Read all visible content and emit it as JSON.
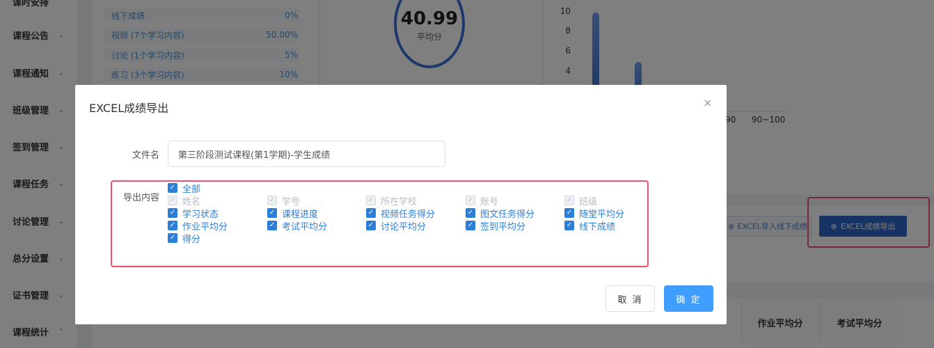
{
  "sidebar": {
    "items": [
      {
        "label": "课时安排"
      },
      {
        "label": "课程公告"
      },
      {
        "label": "课程通知"
      },
      {
        "label": "班级管理"
      },
      {
        "label": "签到管理"
      },
      {
        "label": "课程任务"
      },
      {
        "label": "讨论管理"
      },
      {
        "label": "总分设置"
      },
      {
        "label": "证书管理"
      },
      {
        "label": "课程统计"
      }
    ]
  },
  "stats": {
    "rows": [
      {
        "name": "线下成绩",
        "value": "0%"
      },
      {
        "name": "视频 (7个学习内容)",
        "value": "50.00%"
      },
      {
        "name": "讨论 (1个学习内容)",
        "value": "5%"
      },
      {
        "name": "练习 (3个学习内容)",
        "value": "10%"
      }
    ],
    "average_score": "40.99",
    "average_label": "平均分"
  },
  "chart": {
    "y_ticks": [
      "10",
      "8",
      "6",
      "4"
    ],
    "x_ticks": [
      "90",
      "90~100"
    ]
  },
  "toolbar": {
    "import_label": "EXCEL导入线下成绩",
    "export_label": "EXCEL成绩导出"
  },
  "table": {
    "headers": [
      "作业平均分",
      "考试平均分"
    ]
  },
  "modal": {
    "title": "EXCEL成绩导出",
    "filename_label": "文件名",
    "filename_value": "第三阶段测试课程(第1学期)-学生成绩",
    "content_label": "导出内容",
    "select_all": "全部",
    "options": [
      {
        "label": "姓名",
        "checked": true,
        "disabled": true
      },
      {
        "label": "学号",
        "checked": true,
        "disabled": true
      },
      {
        "label": "所在学校",
        "checked": true,
        "disabled": true
      },
      {
        "label": "账号",
        "checked": true,
        "disabled": true
      },
      {
        "label": "班级",
        "checked": true,
        "disabled": true
      },
      {
        "label": "学习状态",
        "checked": true,
        "disabled": false
      },
      {
        "label": "课程进度",
        "checked": true,
        "disabled": false
      },
      {
        "label": "视频任务得分",
        "checked": true,
        "disabled": false
      },
      {
        "label": "图文任务得分",
        "checked": true,
        "disabled": false
      },
      {
        "label": "随堂平均分",
        "checked": true,
        "disabled": false
      },
      {
        "label": "作业平均分",
        "checked": true,
        "disabled": false
      },
      {
        "label": "考试平均分",
        "checked": true,
        "disabled": false
      },
      {
        "label": "讨论平均分",
        "checked": true,
        "disabled": false
      },
      {
        "label": "签到平均分",
        "checked": true,
        "disabled": false
      },
      {
        "label": "线下成绩",
        "checked": true,
        "disabled": false
      },
      {
        "label": "得分",
        "checked": true,
        "disabled": false
      }
    ],
    "cancel_label": "取 消",
    "confirm_label": "确 定"
  },
  "colors": {
    "primary": "#409eff",
    "highlight": "#f0506e",
    "checkbox": "#2b7fd8"
  }
}
